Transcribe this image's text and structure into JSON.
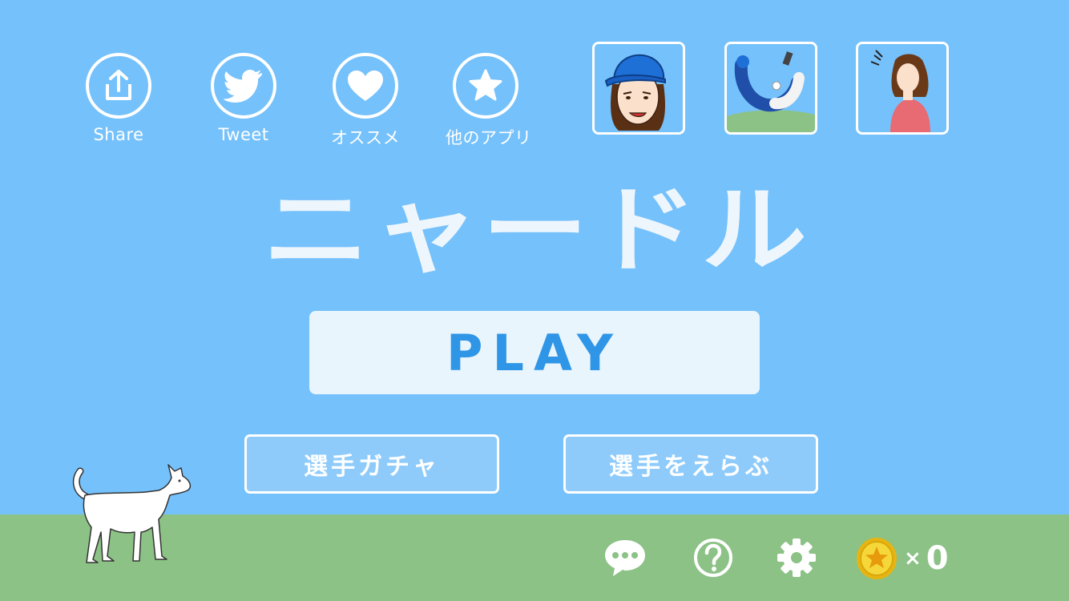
{
  "social": {
    "share_label": "Share",
    "tweet_label": "Tweet",
    "recommend_label": "オススメ",
    "other_apps_label": "他のアプリ"
  },
  "title": "ニャードル",
  "play_label": "PLAY",
  "gacha_label": "選手ガチャ",
  "choose_label": "選手をえらぶ",
  "coins": {
    "multiplier": "×",
    "count": "0"
  },
  "colors": {
    "sky": "#75c1fb",
    "ground": "#8cc286",
    "play_text": "#2f95e6",
    "coin": "#f2cc1d"
  },
  "icons": [
    "share-icon",
    "twitter-bird-icon",
    "heart-icon",
    "star-icon",
    "chat-icon",
    "help-icon",
    "gear-icon",
    "coin-icon"
  ]
}
